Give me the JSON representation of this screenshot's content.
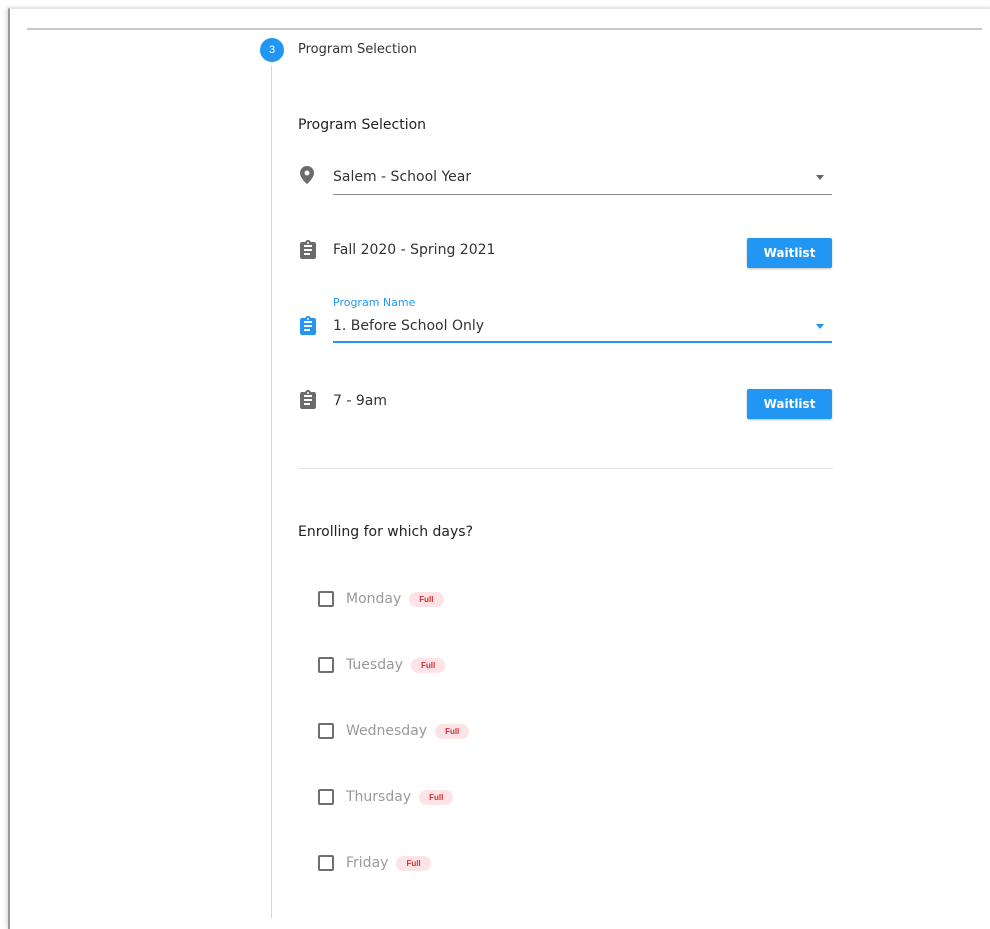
{
  "stepper": {
    "step_number": "3",
    "step_title": "Program Selection"
  },
  "form": {
    "section_title": "Program Selection",
    "location": {
      "value": "Salem - School Year",
      "icon": "map-pin-icon"
    },
    "term": {
      "value": "Fall 2020 - Spring 2021",
      "icon": "clipboard-icon",
      "button_label": "Waitlist"
    },
    "program": {
      "label": "Program Name",
      "value": "1. Before School Only",
      "icon": "clipboard-icon"
    },
    "time_slot": {
      "value": "7 - 9am",
      "icon": "clipboard-icon",
      "button_label": "Waitlist"
    }
  },
  "days": {
    "question": "Enrolling for which days?",
    "items": [
      {
        "label": "Monday",
        "badge": "Full",
        "checked": false
      },
      {
        "label": "Tuesday",
        "badge": "Full",
        "checked": false
      },
      {
        "label": "Wednesday",
        "badge": "Full",
        "checked": false
      },
      {
        "label": "Thursday",
        "badge": "Full",
        "checked": false
      },
      {
        "label": "Friday",
        "badge": "Full",
        "checked": false
      }
    ]
  },
  "colors": {
    "accent": "#2196f3",
    "icon_gray": "#6b6b6b",
    "badge_bg": "#fde3e5",
    "badge_text": "#d32f2f"
  }
}
